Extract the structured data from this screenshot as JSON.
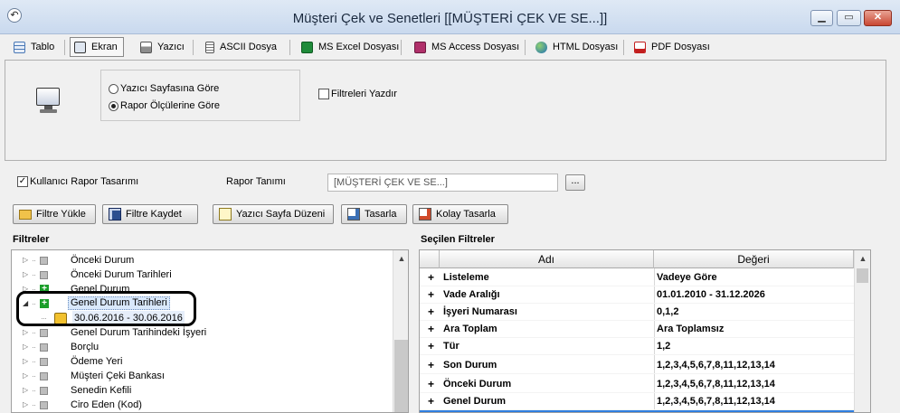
{
  "window": {
    "title": "Müşteri Çek ve Senetleri [[MÜŞTERİ ÇEK VE SE...]]",
    "minimize": "▁",
    "maximize": "▭",
    "close": "✕",
    "app_icon": "↶"
  },
  "tabs": [
    {
      "label": "Tablo",
      "icon": "table-icon",
      "active": false
    },
    {
      "label": "Ekran",
      "icon": "monitor-icon",
      "active": true
    },
    {
      "label": "Yazıcı",
      "icon": "printer-icon",
      "active": false
    },
    {
      "label": "ASCII Dosya",
      "icon": "text-file-icon",
      "active": false
    },
    {
      "label": "MS Excel Dosyası",
      "icon": "excel-icon",
      "active": false
    },
    {
      "label": "MS Access Dosyası",
      "icon": "access-icon",
      "active": false
    },
    {
      "label": "HTML Dosyası",
      "icon": "globe-icon",
      "active": false
    },
    {
      "label": "PDF Dosyası",
      "icon": "pdf-icon",
      "active": false
    }
  ],
  "options": {
    "radio_printer_page": "Yazıcı Sayfasına Göre",
    "radio_report_size": "Rapor Ölçülerine Göre",
    "selected_radio": "radio_report_size",
    "print_filters": "Filtreleri Yazdır",
    "print_filters_checked": false
  },
  "report": {
    "user_design": "Kullanıcı Rapor Tasarımı",
    "user_design_checked": true,
    "name_label": "Rapor Tanımı",
    "name_value": "[MÜŞTERİ ÇEK VE SE...]",
    "browse": "..."
  },
  "buttons": {
    "load_filter": "Filtre Yükle",
    "save_filter": "Filtre Kaydet",
    "page_setup": "Yazıcı Sayfa Düzeni",
    "design": "Tasarla",
    "easy_design": "Kolay Tasarla"
  },
  "filters": {
    "title": "Filtreler",
    "items": [
      {
        "label": "Önceki Durum",
        "state": "none"
      },
      {
        "label": "Önceki Durum Tarihleri",
        "state": "none"
      },
      {
        "label": "Genel Durum",
        "state": "added"
      },
      {
        "label": "Genel Durum Tarihleri",
        "state": "added-expanded"
      },
      {
        "label": "30.06.2016 - 30.06.2016",
        "state": "child"
      },
      {
        "label": "Genel Durum Tarihindeki İşyeri",
        "state": "none"
      },
      {
        "label": "Borçlu",
        "state": "none"
      },
      {
        "label": "Ödeme Yeri",
        "state": "none"
      },
      {
        "label": "Müşteri Çeki Bankası",
        "state": "none"
      },
      {
        "label": "Senedin Kefili",
        "state": "none"
      },
      {
        "label": "Ciro Eden (Kod)",
        "state": "none"
      }
    ]
  },
  "selected_filters": {
    "title": "Seçilen Filtreler",
    "columns": [
      "Adı",
      "Değeri"
    ],
    "rows": [
      {
        "name": "Listeleme",
        "value": "Vadeye Göre"
      },
      {
        "name": "Vade Aralığı",
        "value": "01.01.2010 - 31.12.2026"
      },
      {
        "name": "İşyeri Numarası",
        "value": "0,1,2"
      },
      {
        "name": "Ara Toplam",
        "value": "Ara Toplamsız"
      },
      {
        "name": "Tür",
        "value": "1,2"
      },
      {
        "name": "Son Durum",
        "value": "1,2,3,4,5,6,7,8,11,12,13,14"
      },
      {
        "name": "Önceki Durum",
        "value": "1,2,3,4,5,6,7,8,11,12,13,14"
      },
      {
        "name": "Genel Durum",
        "value": "1,2,3,4,5,6,7,8,11,12,13,14"
      }
    ]
  },
  "colors": {
    "accent": "#2f7fe0",
    "selection": "#d9e8fb",
    "added_marker": "#1b9e2a"
  }
}
